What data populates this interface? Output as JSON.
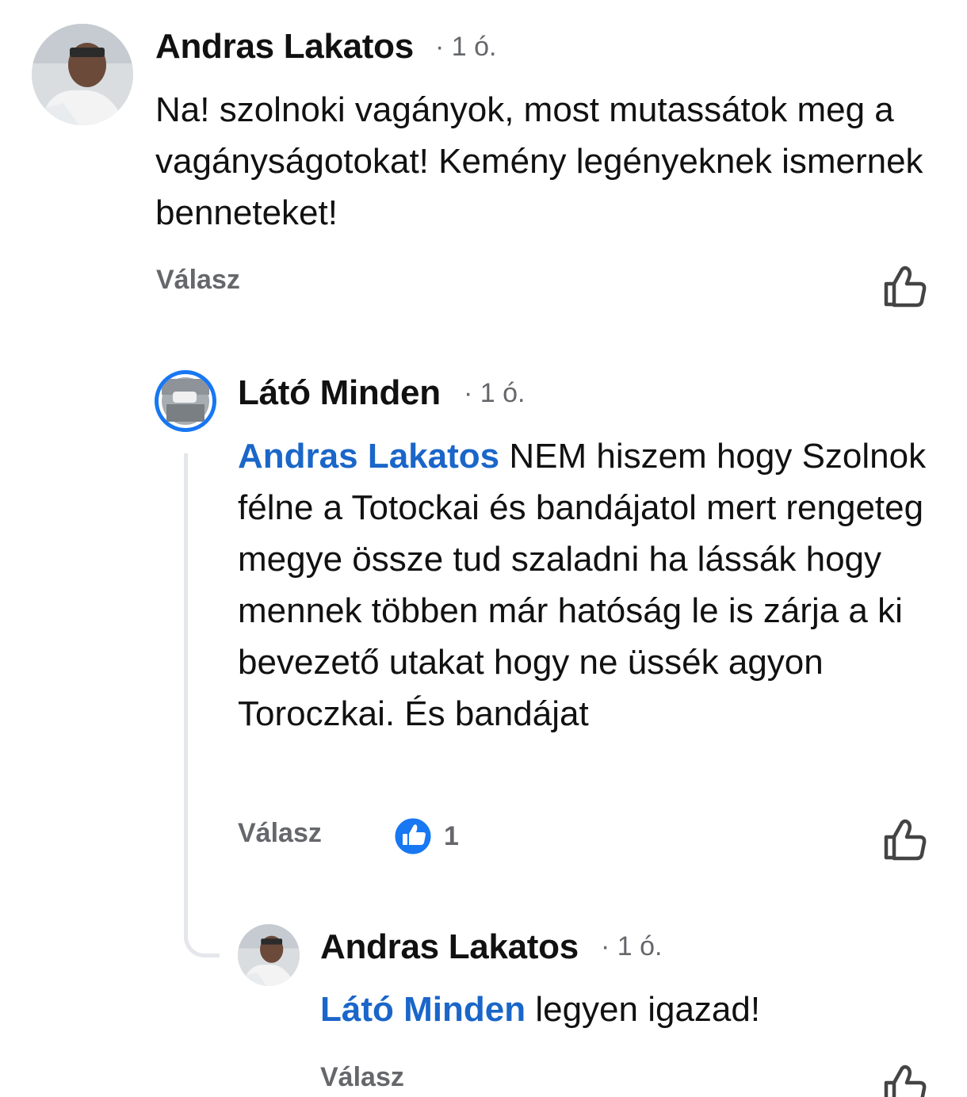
{
  "comments": [
    {
      "author": "Andras Lakatos",
      "time": "· 1 ó.",
      "text": "Na! szolnoki vagányok, most mutassátok meg a vagányságotokat! Kemény legényeknek ismernek benneteket!",
      "reply_label": "Válasz",
      "like_icon": "thumbs-up-outline-icon"
    },
    {
      "author": "Látó Minden",
      "time": "· 1 ó.",
      "mention": "Andras Lakatos",
      "text": "NEM hiszem hogy Szolnok félne a Totockai és bandájatol  mert rengeteg megye össze tud szaladni ha lássák hogy mennek többen már hatóság le is zárja a ki bevezető utakat hogy ne üssék agyon Toroczkai. És  bandájat",
      "reply_label": "Válasz",
      "reaction_count": "1",
      "like_icon": "thumbs-up-outline-icon"
    },
    {
      "author": "Andras Lakatos",
      "time": "· 1 ó.",
      "mention": "Látó Minden",
      "text": "legyen igazad!",
      "reply_label": "Válasz",
      "like_icon": "thumbs-up-outline-icon"
    }
  ],
  "colors": {
    "mention": "#1a66c9",
    "muted": "#65676b",
    "reaction_blue": "#1877f2",
    "story_ring": "#1877f2",
    "thread_line": "#e4e6eb"
  }
}
